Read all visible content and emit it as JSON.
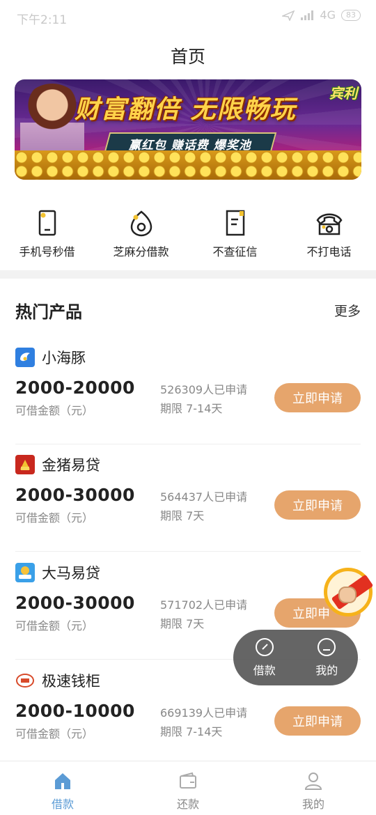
{
  "status_bar": {
    "time": "下午2:11",
    "network": "4G",
    "battery": "83"
  },
  "header": {
    "title": "首页"
  },
  "banner": {
    "headline": "财富翻倍 无限畅玩",
    "ribbon": "赢红包 赚话费 爆奖池",
    "logo_text": "宾利"
  },
  "quick_nav": [
    {
      "label": "手机号秒借",
      "icon": "phone-icon"
    },
    {
      "label": "芝麻分借款",
      "icon": "sesame-icon"
    },
    {
      "label": "不查征信",
      "icon": "document-icon"
    },
    {
      "label": "不打电话",
      "icon": "telephone-icon"
    }
  ],
  "hot_section": {
    "title": "热门产品",
    "more": "更多"
  },
  "products": [
    {
      "name": "小海豚",
      "amount": "2000-20000",
      "amount_label": "可借金额（元）",
      "applied": "526309人已申请",
      "term": "期限 7-14天",
      "button": "立即申请",
      "logo_color": "#2f7fe0"
    },
    {
      "name": "金猪易贷",
      "amount": "2000-30000",
      "amount_label": "可借金额（元）",
      "applied": "564437人已申请",
      "term": "期限 7天",
      "button": "立即申请",
      "logo_color": "#c8281e"
    },
    {
      "name": "大马易贷",
      "amount": "2000-30000",
      "amount_label": "可借金额（元）",
      "applied": "571702人已申请",
      "term": "期限 7天",
      "button": "立即申",
      "logo_color": "#3aa0e8"
    },
    {
      "name": "极速钱柜",
      "amount": "2000-10000",
      "amount_label": "可借金额（元）",
      "applied": "669139人已申请",
      "term": "期限 7-14天",
      "button": "立即申请",
      "logo_color": "#d84a2a"
    }
  ],
  "float_menu": [
    {
      "label": "借款",
      "icon": "compass-icon"
    },
    {
      "label": "我的",
      "icon": "user-circle-icon"
    }
  ],
  "tabbar": [
    {
      "label": "借款",
      "icon": "home-icon",
      "active": true
    },
    {
      "label": "还款",
      "icon": "wallet-icon",
      "active": false
    },
    {
      "label": "我的",
      "icon": "person-icon",
      "active": false
    }
  ],
  "colors": {
    "accent": "#e6a56c",
    "tab_active": "#5b9bd5",
    "muted": "#888888"
  }
}
